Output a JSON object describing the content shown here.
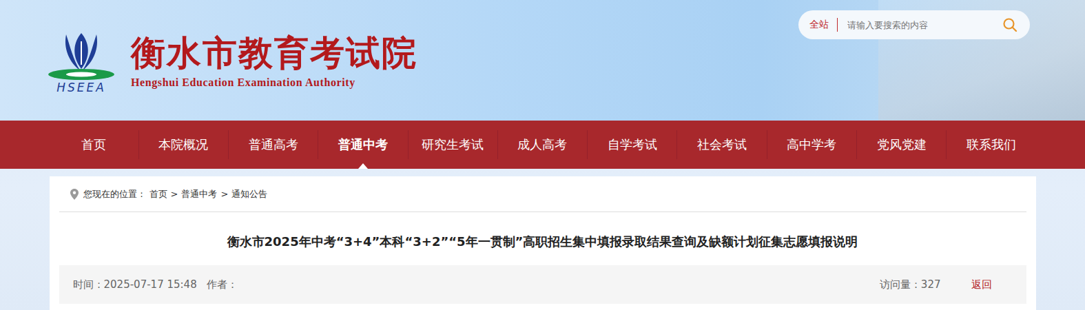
{
  "site": {
    "title": "衡水市教育考试院",
    "subtitle": "Hengshui Education Examination Authority",
    "logo_text": "HSEEA"
  },
  "search": {
    "scope": "全站",
    "placeholder": "请输入要搜索的内容"
  },
  "nav": [
    {
      "label": "首页",
      "selected": false
    },
    {
      "label": "本院概况",
      "selected": false
    },
    {
      "label": "普通高考",
      "selected": false
    },
    {
      "label": "普通中考",
      "selected": true
    },
    {
      "label": "研究生考试",
      "selected": false
    },
    {
      "label": "成人高考",
      "selected": false
    },
    {
      "label": "自学考试",
      "selected": false
    },
    {
      "label": "社会考试",
      "selected": false
    },
    {
      "label": "高中学考",
      "selected": false
    },
    {
      "label": "党风党建",
      "selected": false
    },
    {
      "label": "联系我们",
      "selected": false
    }
  ],
  "breadcrumb": {
    "prefix": "您现在的位置：",
    "separator": ">",
    "items": [
      "首页",
      "普通中考",
      "通知公告"
    ]
  },
  "article": {
    "title": "衡水市2025年中考“3+4”本科“3+2”“5年一贯制”高职招生集中填报录取结果查询及缺额计划征集志愿填报说明",
    "time_label": "时间：",
    "time": "2025-07-17 15:48",
    "author_label": "作者：",
    "views_label": "访问量：",
    "views": "327",
    "back": "返回"
  }
}
